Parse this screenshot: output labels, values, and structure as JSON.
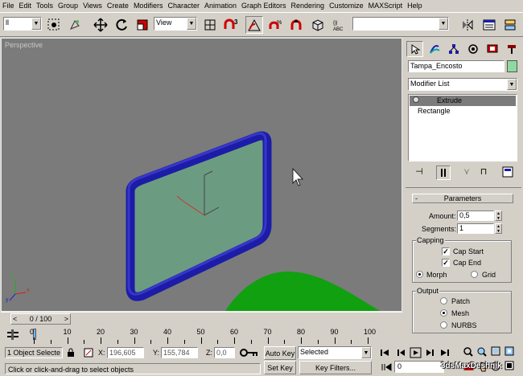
{
  "menu": [
    "File",
    "Edit",
    "Tools",
    "Group",
    "Views",
    "Create",
    "Modifiers",
    "Character",
    "Animation",
    "Graph Editors",
    "Rendering",
    "Customize",
    "MAXScript",
    "Help"
  ],
  "toolbar": {
    "selection_filter": "ll",
    "ref_coord": "View",
    "named_selection": ""
  },
  "viewport": {
    "label": "Perspective",
    "axis_x": "x",
    "axis_y": "y",
    "axis_z": "z"
  },
  "command_panel": {
    "object_name": "Tampa_Encosto",
    "object_color": "#8fd9a0",
    "modifier_list": "Modifier List",
    "stack": [
      "Extrude",
      "Rectangle"
    ],
    "rollout_title": "Parameters",
    "amount_label": "Amount:",
    "amount_value": "0,5",
    "segments_label": "Segments:",
    "segments_value": "1",
    "capping_title": "Capping",
    "cap_start": "Cap Start",
    "cap_end": "Cap End",
    "morph": "Morph",
    "grid": "Grid",
    "output_title": "Output",
    "patch": "Patch",
    "mesh": "Mesh",
    "nurbs": "NURBS"
  },
  "timeline": {
    "frame_display": "0 / 100",
    "ticks": [
      "0",
      "10",
      "20",
      "30",
      "40",
      "50",
      "60",
      "70",
      "80",
      "90",
      "100"
    ]
  },
  "status": {
    "selected_count": "1 Object Selecte",
    "x_label": "X:",
    "x_value": "196,605",
    "y_label": "Y:",
    "y_value": "155,784",
    "z_label": "Z:",
    "z_value": "0,0",
    "prompt": "Click or click-and-drag to select objects",
    "auto_key": "Auto Key",
    "set_key": "Set Key",
    "key_mode": "Selected",
    "key_filters": "Key Filters...",
    "current_frame": "0",
    "watermark": "3dsMaxDeshnik"
  },
  "colors": {
    "viewport_bg": "#7b7b7b",
    "frame_blue": "#1c1ca8",
    "glass": "#6a9e82",
    "ground": "#10a010",
    "stack_selected": "#7b7b7b"
  }
}
